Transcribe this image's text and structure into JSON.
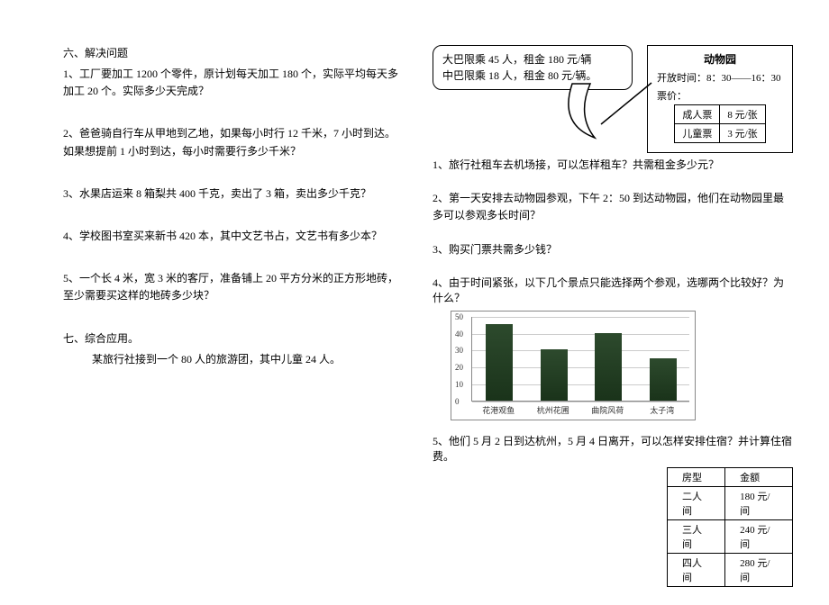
{
  "left": {
    "sec6_title": "六、解决问题",
    "q1": "1、工厂要加工 1200 个零件，原计划每天加工 180 个，实际平均每天多加工 20 个。实际多少天完成？",
    "q2": "2、爸爸骑自行车从甲地到乙地，如果每小时行 12 千米，7 小时到达。如果想提前 1 小时到达，每小时需要行多少千米？",
    "q3": "3、水果店运来 8 箱梨共 400 千克，卖出了 3 箱，卖出多少千克？",
    "q4": "4、学校图书室买来新书 420 本，其中文艺书占，文艺书有多少本？",
    "q5": "5、一个长 4 米，宽 3 米的客厅，准备铺上 20 平方分米的正方形地砖，至少需要买这样的地砖多少块？",
    "sec7_title": "七、综合应用。",
    "sec7_body": "某旅行社接到一个 80 人的旅游团，其中儿童 24 人。"
  },
  "right": {
    "bubble_l1": "大巴限乘 45 人，租金 180 元/辆",
    "bubble_l2": "中巴限乘 18 人，租金 80 元/辆。",
    "zoo_title": "动物园",
    "zoo_time": "开放时间：8：30——16：30",
    "zoo_price_label": "票价：",
    "adult_label": "成人票",
    "adult_price": "8 元/张",
    "child_label": "儿童票",
    "child_price": "3 元/张",
    "rq1": "1、旅行社租车去机场接，可以怎样租车？共需租金多少元？",
    "rq2": "2、第一天安排去动物园参观，下午 2：50 到达动物园，他们在动物园里最多可以参观多长时间？",
    "rq3": "3、购买门票共需多少钱？",
    "rq4": "4、由于时间紧张，以下几个景点只能选择两个参观，选哪两个比较好？为什么？",
    "rq5": "5、他们 5 月 2 日到达杭州，5 月 4 日离开，可以怎样安排住宿？并计算住宿费。",
    "room_h1": "房型",
    "room_h2": "金额",
    "room_r1c1": "二人间",
    "room_r1c2": "180 元/间",
    "room_r2c1": "三人间",
    "room_r2c2": "240 元/间",
    "room_r3c1": "四人间",
    "room_r3c2": "280 元/间"
  },
  "chart_data": {
    "type": "bar",
    "categories": [
      "花港观鱼",
      "杭州花圃",
      "曲院风荷",
      "太子湾"
    ],
    "values": [
      45,
      30,
      40,
      25
    ],
    "title": "",
    "xlabel": "",
    "ylabel": "",
    "ylim": [
      0,
      50
    ],
    "yticks": [
      0,
      10,
      20,
      30,
      40,
      50
    ]
  }
}
